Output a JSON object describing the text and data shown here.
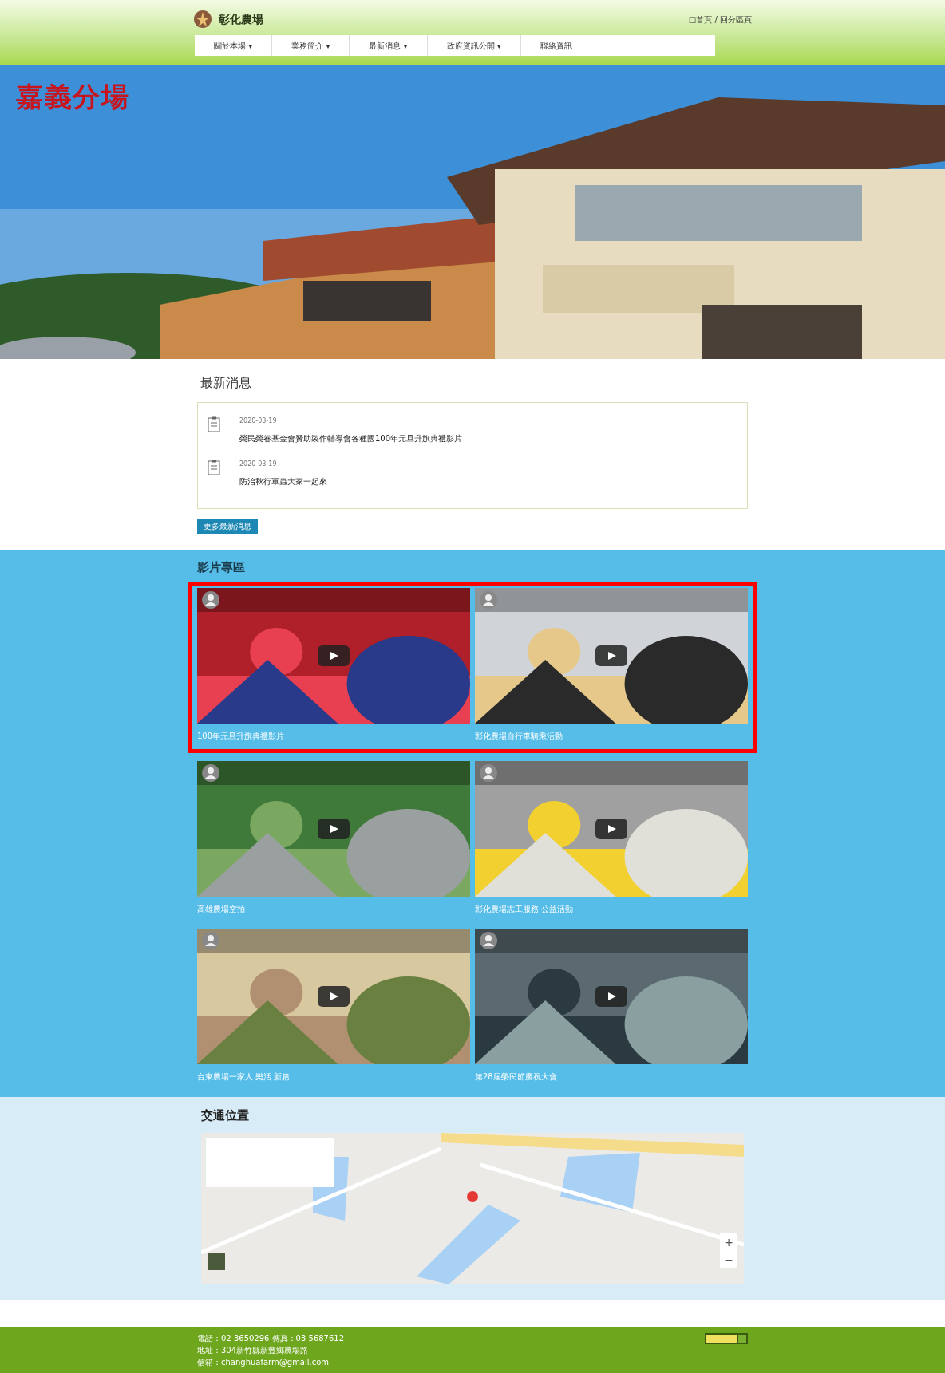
{
  "header": {
    "logo_text": "彰化農場",
    "top_links": "□首頁 / 回分區頁",
    "nav": [
      {
        "label": "關於本場 ▾"
      },
      {
        "label": "業務簡介 ▾"
      },
      {
        "label": "最新消息 ▾"
      },
      {
        "label": "政府資訊公開 ▾"
      },
      {
        "label": "聯絡資訊"
      }
    ]
  },
  "hero": {
    "title": "嘉義分場"
  },
  "news": {
    "heading": "最新消息",
    "items": [
      {
        "date": "2020-03-19",
        "title": "榮民榮眷基金會贊助製作輔導會各種國100年元旦升旗典禮影片"
      },
      {
        "date": "2020-03-19",
        "title": "防治秋行軍蟲大家一起來"
      }
    ],
    "more_button": "更多最新消息"
  },
  "videos": {
    "heading": "影片專區",
    "rows": [
      {
        "highlighted": true,
        "items": [
          {
            "caption": "100年元旦升旗典禮影片"
          },
          {
            "caption": "彰化農場自行車騎乘活動"
          }
        ]
      },
      {
        "highlighted": false,
        "items": [
          {
            "caption": "高雄農場空拍"
          },
          {
            "caption": "彰化農場志工服務 公益活動"
          }
        ]
      },
      {
        "highlighted": false,
        "items": [
          {
            "caption": "台東農場一家人 樂活 新篇"
          },
          {
            "caption": "第28屆榮民節慶祝大會"
          }
        ]
      }
    ]
  },
  "location": {
    "heading": "交通位置",
    "zoom_in": "+",
    "zoom_out": "−"
  },
  "footer": {
    "lines": [
      "電話：02 3650296 傳真：03 5687612",
      "地址：304新竹縣新豐鄉農場路",
      "信箱：changhuafarm@gmail.com"
    ]
  }
}
